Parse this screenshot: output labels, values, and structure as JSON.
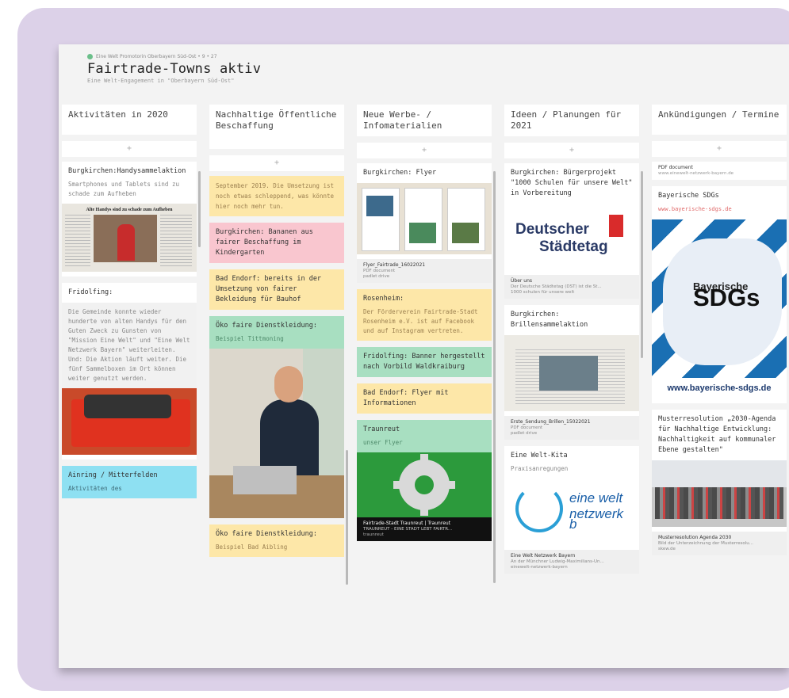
{
  "header": {
    "meta": "Eine Welt Promotorin Oberbayern Süd-Ost • 9 • 27",
    "title": "Fairtrade-Towns aktiv",
    "subtitle": "Eine Welt-Engagement in \"Oberbayern Süd-Ost\""
  },
  "add_label": "+",
  "columns": [
    {
      "title": "Aktivitäten in 2020",
      "posts": [
        {
          "title": "Burgkirchen:Handysammelaktion",
          "body": "Smartphones und Tablets sind zu schade zum Aufheben",
          "image_caption": "Alte Handys sind zu schade zum Aufheben"
        },
        {
          "title": "Fridolfing:",
          "body": "Die Gemeinde konnte wieder hunderte von alten Handys für den Guten Zweck zu Gunsten von \"Mission Eine Welt\" und \"Eine Welt Netzwerk Bayern\" weiterleiten. Und: Die Aktion läuft weiter. Die fünf Sammelboxen im Ort können weiter genutzt werden."
        },
        {
          "title": "Ainring / Mitterfelden",
          "body": "Aktivitäten des"
        }
      ]
    },
    {
      "title": "Nachhaltige Öffentliche Beschaffung",
      "posts": [
        {
          "title": "September 2019. Die Umsetzung ist noch etwas schleppend, was könnte hier noch mehr tun."
        },
        {
          "title": "Burgkirchen: Bananen aus fairer Beschaffung im Kindergarten"
        },
        {
          "title": "Bad Endorf: bereits in der Umsetzung von fairer Bekleidung für Bauhof"
        },
        {
          "title": "Öko faire Dienstkleidung:",
          "body": "Beispiel Tittmoning"
        },
        {
          "title": "Öko faire Dienstkleidung:",
          "body": "Beispiel Bad Aibling"
        }
      ]
    },
    {
      "title": "Neue Werbe- / Infomaterialien",
      "posts": [
        {
          "title": "Burgkirchen: Flyer",
          "file": "Flyer_Fairtrade_16022021",
          "filetype": "PDF document",
          "source": "padlet drive"
        },
        {
          "title": "Rosenheim:",
          "body": "Der Förderverein Fairtrade-Stadt Rosenheim e.V. ist auf Facebook und auf Instagram vertreten."
        },
        {
          "title": "Fridolfing: Banner hergestellt nach Vorbild Waldkraiburg"
        },
        {
          "title": "Bad Endorf: Flyer mit Informationen"
        },
        {
          "title": "Traunreut",
          "body": "unser Flyer",
          "caption": "Fairtrade-Stadt Traunreut | Traunreut",
          "caption_sub": "TRAUNREUT - EINE STADT LEBT FAIRTR...",
          "caption_src": "traunreut"
        }
      ]
    },
    {
      "title": "Ideen / Planungen für 2021",
      "posts": [
        {
          "title": "Burgkirchen: Bürgerprojekt \"1000 Schulen für unsere Welt\" in Vorbereitung",
          "logo1": "Deutscher",
          "logo2": "Städtetag",
          "file": "Über uns",
          "filetype": "Der Deutsche Städtetag (DST) ist die St...",
          "source": "1000 schulen für unsere welt"
        },
        {
          "title": "Burgkirchen: Brillensammelaktion",
          "file": "Erste_Sendung_Brillen_15022021",
          "filetype": "PDF document",
          "source": "padlet drive"
        },
        {
          "title": "Eine Welt-Kita",
          "body": "Praxisanregungen",
          "logo1": "eine welt",
          "logo2": "netzwerk b",
          "file": "Eine Welt Netzwerk Bayern",
          "filetype": "An der Münchner Ludwig-Maximilians-Un...",
          "source": "einewelt-netzwerk-bayern"
        }
      ]
    },
    {
      "title": "Ankündigungen / Termine",
      "posts": [
        {
          "title": "PDF document",
          "body": "www.einewelt-netzwerk-bayern.de"
        },
        {
          "title": "Bayerische SDGs",
          "link": "www.bayerische-sdgs.de",
          "logo1": "Bayerische",
          "logo2": "SDGs",
          "logo_url": "www.bayerische-sdgs.de"
        },
        {
          "title": "Musterresolution „2030-Agenda für Nachhaltige Entwicklung: Nachhaltigkeit auf kommunaler Ebene gestalten\"",
          "file": "Musterresolution Agenda 2030",
          "filetype": "Bild der Unterzeichnung der Musterresolu...",
          "source": "skew.de"
        }
      ]
    }
  ],
  "colors": {
    "background": "#dcd1e8",
    "board": "#f3f3f3",
    "yellow": "#fde7a8",
    "pink": "#f9c6cf",
    "green": "#a8dfc1",
    "cyan": "#8ee0f2",
    "sdg_blue": "#1a6fb3"
  }
}
